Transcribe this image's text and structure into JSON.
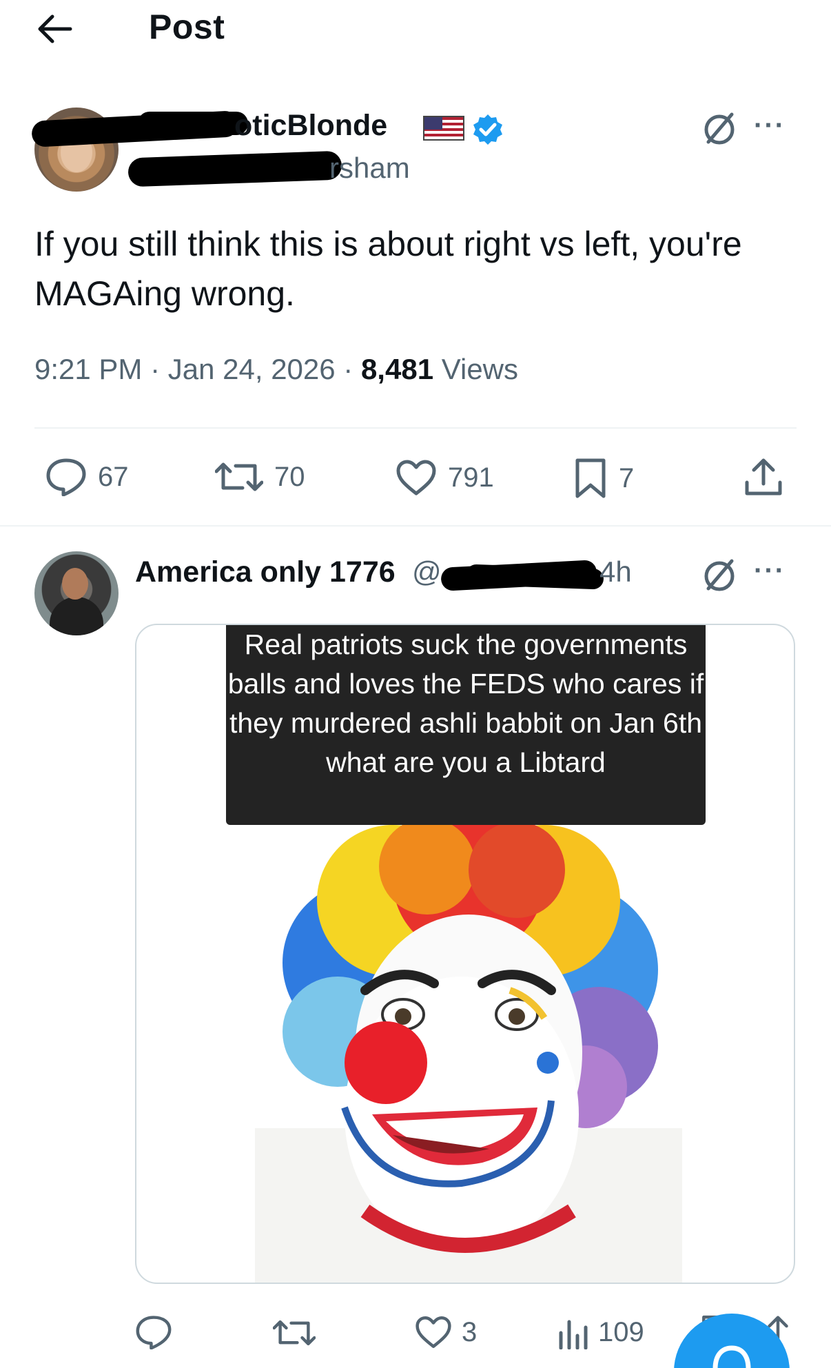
{
  "header": {
    "title": "Post"
  },
  "post": {
    "display_name": "oticBlonde",
    "handle": "rsham",
    "text": "If you still think this is about right vs left, you're MAGAing wrong.",
    "time": "9:21 PM",
    "separator1": " · ",
    "date": "Jan 24, 2026",
    "separator2": " · ",
    "views_count": "8,481",
    "views_label": " Views",
    "stats": {
      "replies": "67",
      "reposts": "70",
      "likes": "791",
      "bookmarks": "7"
    },
    "icons": [
      "back-arrow-icon",
      "flag-icon",
      "verified-badge-icon",
      "grok-icon",
      "more-icon",
      "reply-icon",
      "repost-icon",
      "like-icon",
      "bookmark-icon",
      "share-icon"
    ]
  },
  "reply": {
    "display_name": "America only 1776",
    "handle_prefix": "@",
    "time": "4h",
    "image_caption": "Real patriots suck the governments balls and loves the FEDS who cares if they murdered ashli babbit on Jan 6th what are you a Libtard",
    "stats": {
      "replies": "",
      "reposts": "",
      "likes": "3",
      "views": "109"
    }
  },
  "colors": {
    "accent": "#1d9bf0",
    "text": "#0f1419",
    "muted": "#536471",
    "divider": "#eff3f4"
  }
}
